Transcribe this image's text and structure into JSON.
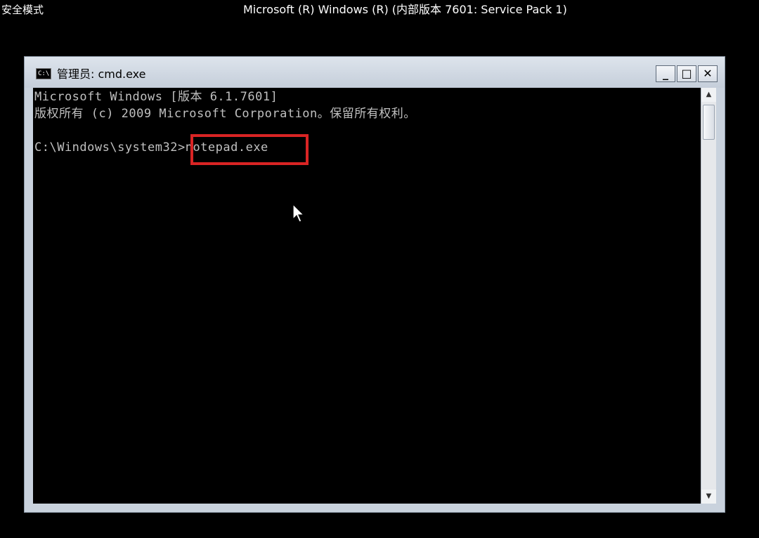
{
  "desktop": {
    "safe_mode_label": "安全模式",
    "os_title": "Microsoft (R) Windows (R) (内部版本 7601: Service Pack 1)"
  },
  "window": {
    "title": "管理员: cmd.exe",
    "icon_name": "console-app-icon",
    "icon_text": "C:\\",
    "minimize_label": "_",
    "maximize_label": "□",
    "close_label": "✕"
  },
  "console": {
    "lines": [
      "Microsoft Windows [版本 6.1.7601]",
      "版权所有 (c) 2009 Microsoft Corporation。保留所有权利。"
    ],
    "prompt": "C:\\Windows\\system32>",
    "input": "notepad.exe"
  },
  "colors": {
    "highlight": "#d92424",
    "console_bg": "#000000",
    "console_text": "#c0c0c0"
  }
}
